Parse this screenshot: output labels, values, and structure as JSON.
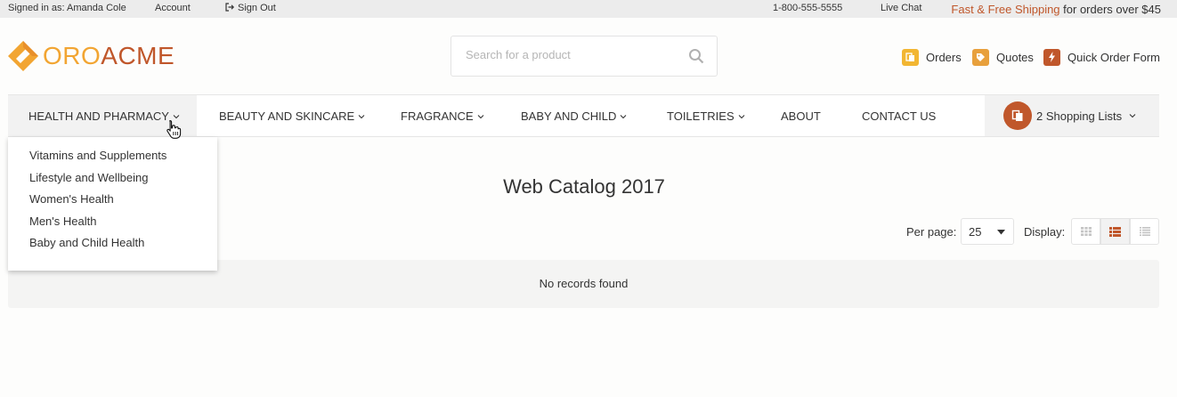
{
  "topbar": {
    "signed_in": "Signed in as: Amanda Cole",
    "account": "Account",
    "sign_out": "Sign Out",
    "phone": "1-800-555-5555",
    "live_chat": "Live Chat",
    "shipping_accent": "Fast & Free Shipping",
    "shipping_rest": " for orders over $45"
  },
  "logo": {
    "part1": "ORO",
    "part2": "ACME"
  },
  "search": {
    "placeholder": "Search for a product"
  },
  "header_links": {
    "orders": "Orders",
    "quotes": "Quotes",
    "quick_order": "Quick Order Form"
  },
  "nav": {
    "items": [
      "HEALTH AND PHARMACY",
      "BEAUTY AND SKINCARE",
      "FRAGRANCE",
      "BABY AND CHILD",
      "TOILETRIES",
      "ABOUT",
      "CONTACT US"
    ],
    "shopping_lists": "2 Shopping Lists"
  },
  "dropdown": {
    "items": [
      "Vitamins and Supplements",
      "Lifestyle and Wellbeing",
      "Women's Health",
      "Men's Health",
      "Baby and Child Health"
    ]
  },
  "main": {
    "title": "Web Catalog 2017",
    "per_page_label": "Per page:",
    "per_page_value": "25",
    "display_label": "Display:",
    "empty_message": "No records found"
  },
  "colors": {
    "accent": "#c0572b",
    "brand_yellow": "#f2a532",
    "icon_orange": "#e8a03c"
  }
}
